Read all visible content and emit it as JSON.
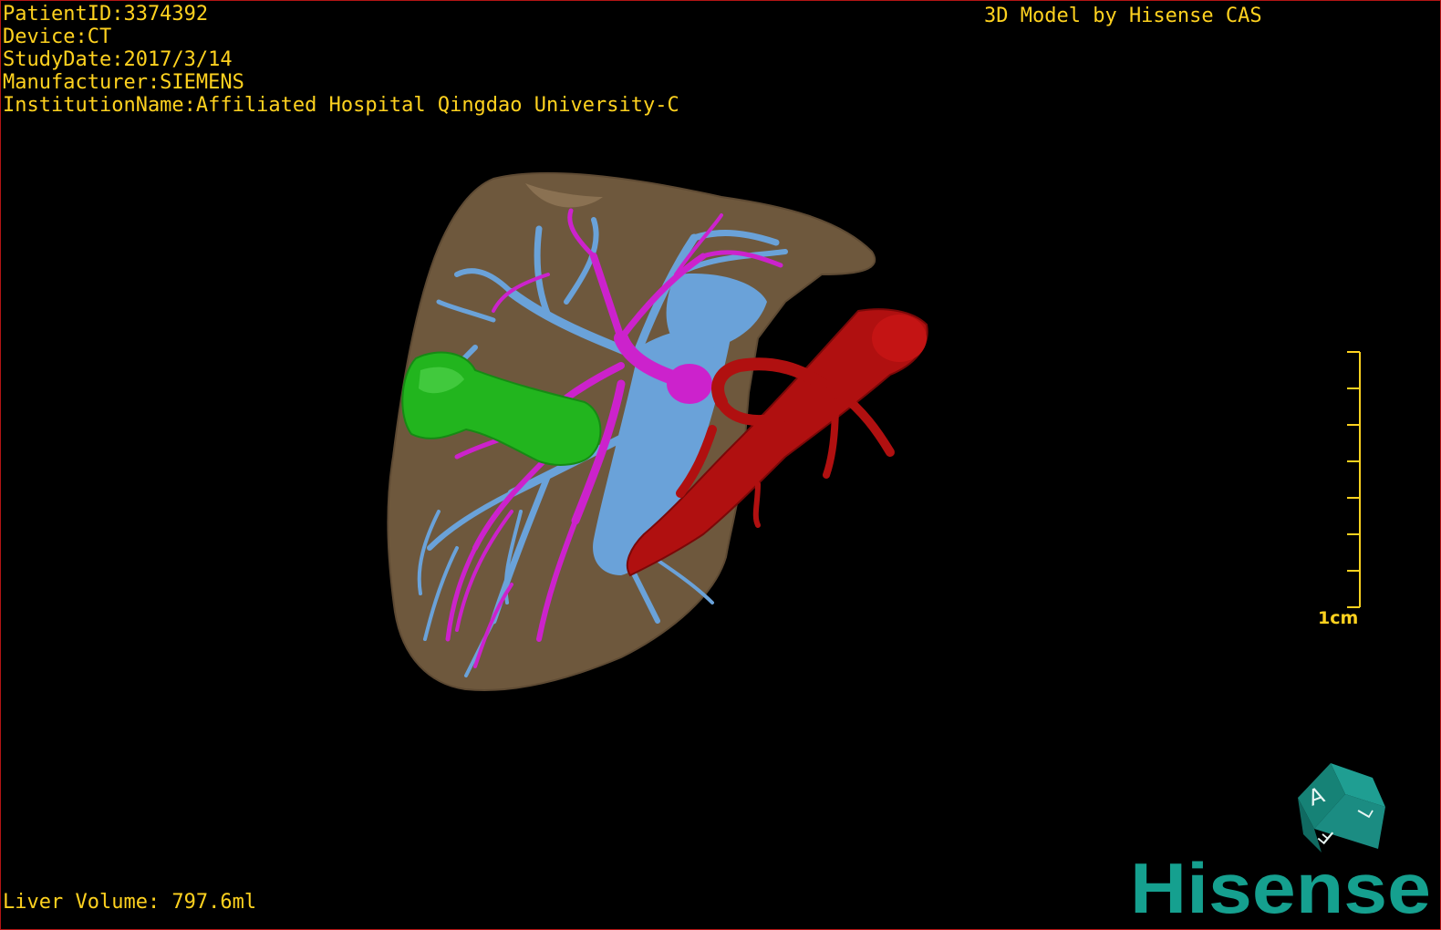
{
  "info": {
    "patient_id": "PatientID:3374392",
    "device": "Device:CT",
    "study_date": "StudyDate:2017/3/14",
    "manufacturer": "Manufacturer:SIEMENS",
    "institution": "InstitutionName:Affiliated Hospital Qingdao University-C"
  },
  "model_credit": "3D Model by Hisense CAS",
  "liver_volume": "Liver Volume: 797.6ml",
  "scale": {
    "label": "1cm",
    "ticks": 8
  },
  "orientation_cube": {
    "faces": [
      "A",
      "F",
      "L"
    ],
    "color": "#1b8c82"
  },
  "brand": {
    "name": "Hisense",
    "color": "#15a08f"
  },
  "colors": {
    "text": "#ffd21f",
    "liver": "#7a6244",
    "portal_vein": "#6aa2d9",
    "hepatic_artery": "#cc22cc",
    "tumor": "#22b51e",
    "aorta": "#b01010",
    "border": "#b31414"
  },
  "structures": [
    {
      "name": "liver-surface",
      "icon": "liver-mesh"
    },
    {
      "name": "portal-vein",
      "icon": "vessel-tree"
    },
    {
      "name": "hepatic-artery",
      "icon": "vessel-tree"
    },
    {
      "name": "tumor",
      "icon": "lesion-mesh"
    },
    {
      "name": "aorta",
      "icon": "vessel-tube"
    }
  ]
}
